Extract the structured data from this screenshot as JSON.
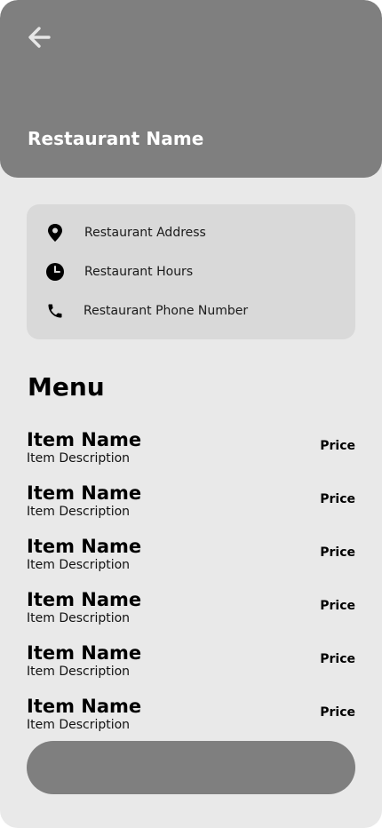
{
  "header": {
    "title": "Restaurant Name",
    "back_icon": "arrow-left-icon",
    "background": "#7f7f7f"
  },
  "info": {
    "address": {
      "icon": "location-pin-icon",
      "label": "Restaurant Address"
    },
    "hours": {
      "icon": "clock-icon",
      "label": "Restaurant Hours"
    },
    "phone": {
      "icon": "phone-icon",
      "label": "Restaurant Phone Number"
    }
  },
  "menu": {
    "title": "Menu",
    "items": [
      {
        "name": "Item Name",
        "description": "Item Description",
        "price": "Price"
      },
      {
        "name": "Item Name",
        "description": "Item Description",
        "price": "Price"
      },
      {
        "name": "Item Name",
        "description": "Item Description",
        "price": "Price"
      },
      {
        "name": "Item Name",
        "description": "Item Description",
        "price": "Price"
      },
      {
        "name": "Item Name",
        "description": "Item Description",
        "price": "Price"
      },
      {
        "name": "Item Name",
        "description": "Item Description",
        "price": "Price"
      }
    ]
  },
  "colors": {
    "page_background": "#e9e9e9",
    "card_background": "#d9d9d9",
    "accent_gray": "#7f7f7f"
  }
}
